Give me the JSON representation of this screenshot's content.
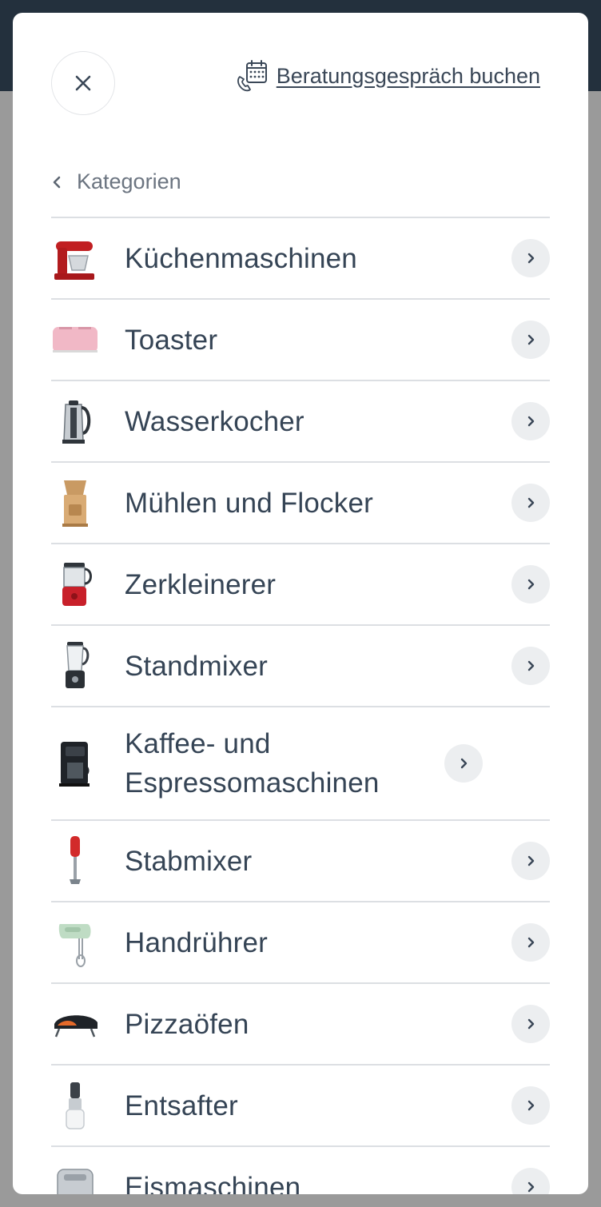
{
  "header": {
    "consultation_link": "Beratungsgespräch buchen"
  },
  "nav": {
    "back_label": "Kategorien"
  },
  "categories": [
    {
      "label": "Küchenmaschinen",
      "icon": "stand-mixer-icon"
    },
    {
      "label": "Toaster",
      "icon": "toaster-icon"
    },
    {
      "label": "Wasserkocher",
      "icon": "kettle-icon"
    },
    {
      "label": "Mühlen und Flocker",
      "icon": "grain-mill-icon"
    },
    {
      "label": "Zerkleinerer",
      "icon": "chopper-icon"
    },
    {
      "label": "Standmixer",
      "icon": "blender-icon"
    },
    {
      "label": "Kaffee- und Espressomaschinen",
      "icon": "coffee-machine-icon"
    },
    {
      "label": "Stabmixer",
      "icon": "hand-blender-icon"
    },
    {
      "label": "Handrührer",
      "icon": "hand-mixer-icon"
    },
    {
      "label": "Pizzaöfen",
      "icon": "pizza-oven-icon"
    },
    {
      "label": "Entsafter",
      "icon": "juicer-icon"
    },
    {
      "label": "Eismaschinen",
      "icon": "ice-cream-maker-icon"
    }
  ],
  "colors": {
    "top_bar": "#23303d",
    "overlay": "#9a9a9a",
    "text": "#354455",
    "divider": "#dcdfe3",
    "chevron_bg": "#eceef0"
  }
}
